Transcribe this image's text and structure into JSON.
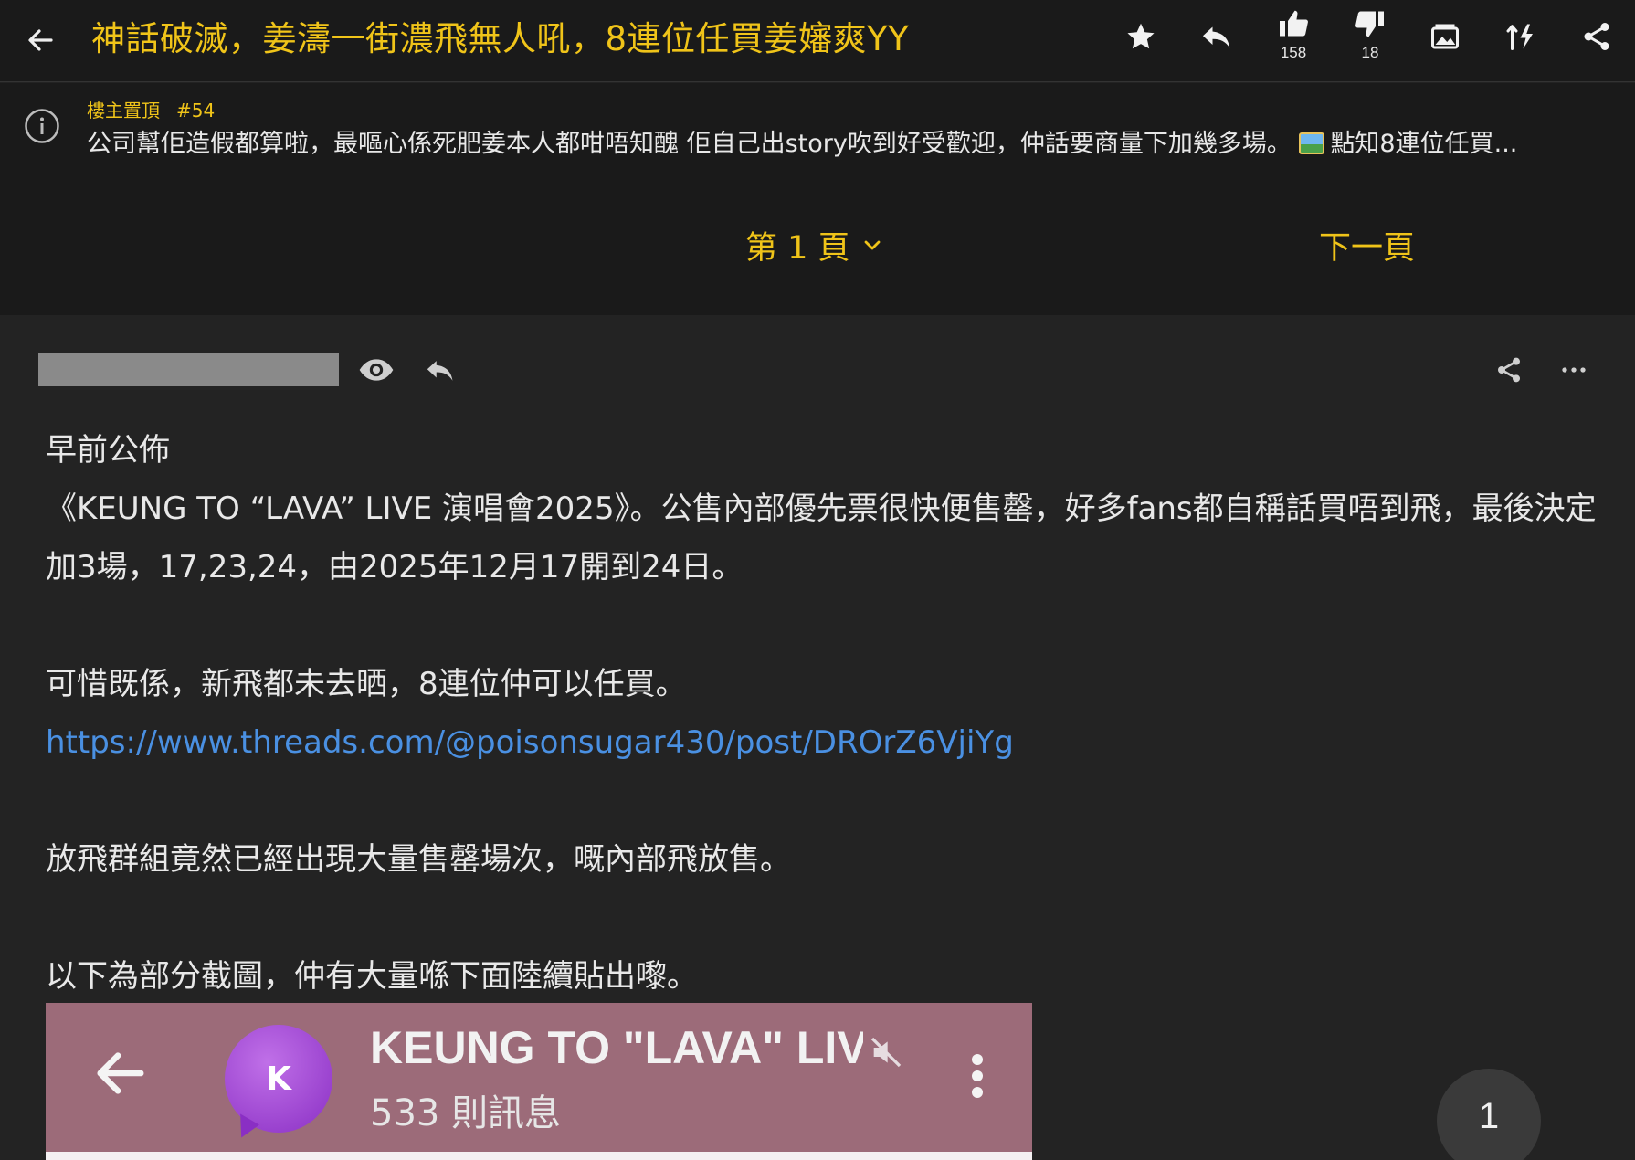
{
  "header": {
    "title": "神話破滅，姜濤一街濃飛無人吼，8連位任買姜嬸爽YY",
    "like_count": "158",
    "dislike_count": "18",
    "icons": [
      "back-arrow-icon",
      "star-icon",
      "reply-icon",
      "thumbs-up-icon",
      "thumbs-down-icon",
      "image-icon",
      "sort-icon",
      "share-icon"
    ]
  },
  "pinned": {
    "label": "樓主置頂",
    "floor": "#54",
    "text": "公司幫佢造假都算啦，最嘔心係死肥姜本人都咁唔知醜 佢自己出story吹到好受歡迎，仲話要商量下加幾多場。",
    "text_tail": "點知8連位任買..."
  },
  "pagination": {
    "current_page": "第 1 頁",
    "next_label": "下一頁"
  },
  "post": {
    "lines": [
      "早前公佈",
      "《KEUNG TO “LAVA” LIVE 演唱會2025》。公售內部優先票很快便售罄，好多fans都自稱話買唔到飛，最後決定加3場，17,23,24，由2025年12月17開到24日。",
      "可惜既係，新飛都未去晒，8連位仲可以任買。",
      "https://www.threads.com/@poisonsugar430/post/DROrZ6VjiYg",
      "放飛群組竟然已經出現大量售罄場次，嘅內部飛放售。",
      "以下為部分截圖，仲有大量喺下面陸續貼出嚟。"
    ],
    "embed": {
      "avatar_letter": "K",
      "title": "KEUNG TO \"LAVA\" LIV",
      "subtitle": "533 則訊息"
    }
  },
  "page_badge": "1",
  "colors": {
    "accent": "#f0c419",
    "link": "#4a90e2",
    "background": "#232323",
    "bar": "#1a1a1a"
  }
}
